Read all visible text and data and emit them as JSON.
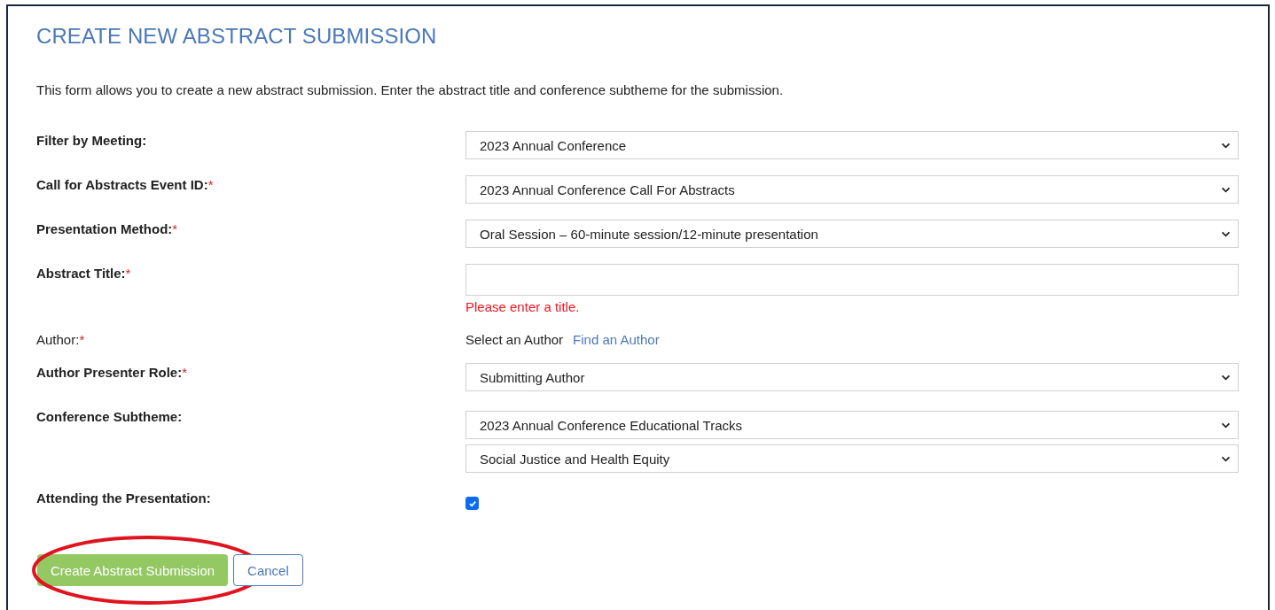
{
  "title": "CREATE NEW ABSTRACT SUBMISSION",
  "intro": "This form allows you to create a new abstract submission. Enter the abstract title and conference subtheme for the submission.",
  "fields": [
    {
      "kind": "select",
      "label": "Filter by Meeting:",
      "bold": true,
      "values": [
        "2023 Annual Conference"
      ]
    },
    {
      "kind": "select",
      "label": "Call for Abstracts Event ID:",
      "required_mark": "*",
      "bold": true,
      "values": [
        "2023 Annual Conference Call For Abstracts"
      ]
    },
    {
      "kind": "select",
      "label": "Presentation Method:",
      "required_mark": "*",
      "bold": true,
      "values": [
        "Oral Session – 60-minute session/12-minute presentation"
      ]
    },
    {
      "kind": "text",
      "label": "Abstract Title:",
      "required_mark": "*",
      "bold": true,
      "error": "Please enter a title."
    },
    {
      "kind": "author",
      "label": "Author:",
      "required_mark": "*",
      "bold": false,
      "text": "Select an Author",
      "link": "Find an Author"
    },
    {
      "kind": "select",
      "label": "Author Presenter Role:",
      "required_mark": "*",
      "bold": true,
      "values": [
        "Submitting Author"
      ]
    },
    {
      "kind": "select",
      "label": "Conference Subtheme:",
      "bold": true,
      "values": [
        "2023 Annual Conference Educational Tracks",
        "Social Justice and Health Equity"
      ]
    },
    {
      "kind": "checkbox",
      "label": "Attending the Presentation:",
      "bold": true,
      "checked": true
    }
  ],
  "buttons": [
    {
      "label": "Create Abstract Submission",
      "kind": "primary",
      "highlighted": true
    },
    {
      "label": "Cancel",
      "kind": "secondary",
      "highlighted": false
    }
  ]
}
